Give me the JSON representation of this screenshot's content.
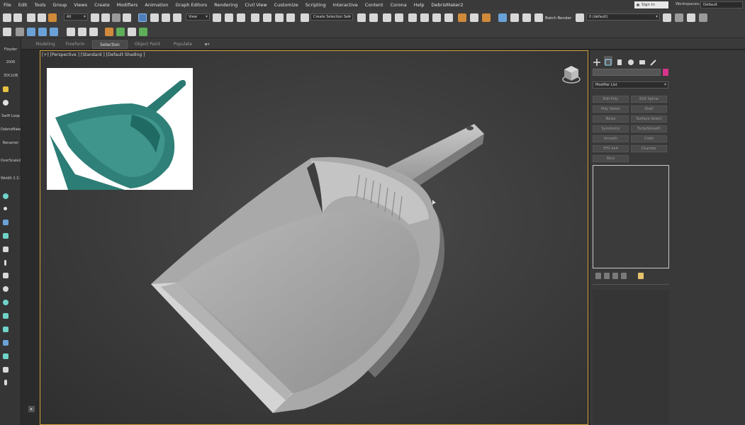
{
  "menu": [
    "File",
    "Edit",
    "Tools",
    "Group",
    "Views",
    "Create",
    "Modifiers",
    "Animation",
    "Graph Editors",
    "Rendering",
    "Civil View",
    "Customize",
    "Scripting",
    "Interactive",
    "Content",
    "Corona",
    "Help",
    "DebrisMaker2"
  ],
  "signin": "Sign In",
  "workspaces_label": "Workspaces:",
  "workspace_value": "Default",
  "toolbar": {
    "filter_all": "All",
    "ref_coord": "View",
    "selection_set": "Create Selection Set",
    "batch_render": "Batch Render",
    "layer": "0 (default)"
  },
  "ribbon_tabs": [
    {
      "label": "Modeling",
      "active": false
    },
    {
      "label": "Freeform",
      "active": false
    },
    {
      "label": "Selection",
      "active": true
    },
    {
      "label": "Object Paint",
      "active": false
    },
    {
      "label": "Populate",
      "active": false
    }
  ],
  "left_panel": [
    "Floyder",
    "2006",
    "3DCLUB",
    "Swift Loop",
    "DebrisMaker",
    "Renamer",
    "OverScale23",
    "WeldIt 2.3.1"
  ],
  "viewport": {
    "label": "[+] [Perspective ] [Standard ] [Default Shading ]"
  },
  "command_panel": {
    "modifier_list": "Modifier List",
    "buttons": [
      "Edit Poly",
      "Edit Spline",
      "Poly Select",
      "Shell",
      "Noise",
      "Surface Select",
      "Symmetry",
      "TurboSmooth",
      "Smooth",
      "Cloth",
      "FFD 4x4",
      "Chamfer",
      "Slice"
    ],
    "color": "#d6338c"
  },
  "colors": {
    "viewport_border": "#cfa33a",
    "reference_plastic": "#2f7f76"
  }
}
